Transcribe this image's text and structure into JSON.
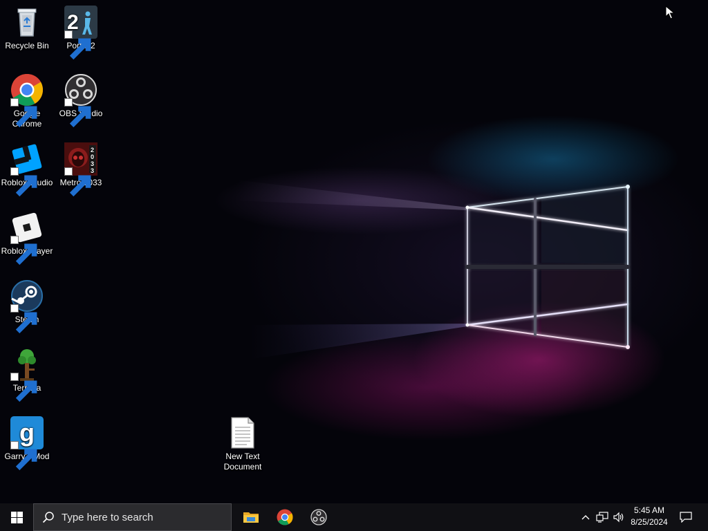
{
  "desktop": {
    "icons": [
      {
        "name": "recycle-bin",
        "label": "Recycle Bin",
        "icon": "recycle-bin-icon"
      },
      {
        "name": "portal-2",
        "label": "Portal 2",
        "icon": "portal-2-icon"
      },
      {
        "name": "google-chrome",
        "label": "Google Chrome",
        "icon": "chrome-icon"
      },
      {
        "name": "obs-studio",
        "label": "OBS Studio",
        "icon": "obs-icon"
      },
      {
        "name": "roblox-studio",
        "label": "Roblox Studio",
        "icon": "roblox-studio-icon"
      },
      {
        "name": "metro-2033",
        "label": "Metro 2033",
        "icon": "metro-2033-icon"
      },
      {
        "name": "roblox-player",
        "label": "Roblox Player",
        "icon": "roblox-player-icon"
      },
      {
        "name": "steam",
        "label": "Steam",
        "icon": "steam-icon"
      },
      {
        "name": "terraria",
        "label": "Terraria",
        "icon": "terraria-icon"
      },
      {
        "name": "garrys-mod",
        "label": "Garry's Mod",
        "icon": "garrys-mod-icon"
      },
      {
        "name": "new-text-document",
        "label": "New Text Document",
        "icon": "text-document-icon"
      }
    ]
  },
  "taskbar": {
    "search_placeholder": "Type here to search",
    "pinned": [
      "file-explorer-icon",
      "chrome-icon",
      "obs-icon"
    ],
    "clock": {
      "time": "5:45 AM",
      "date": "8/25/2024"
    }
  },
  "colors": {
    "taskbar_bg": "#101014",
    "search_bg": "#2b2b2e",
    "accent_blue": "#1f8ad8",
    "wallpaper_pink": "#be1e82",
    "wallpaper_cyan": "#1478aa"
  }
}
